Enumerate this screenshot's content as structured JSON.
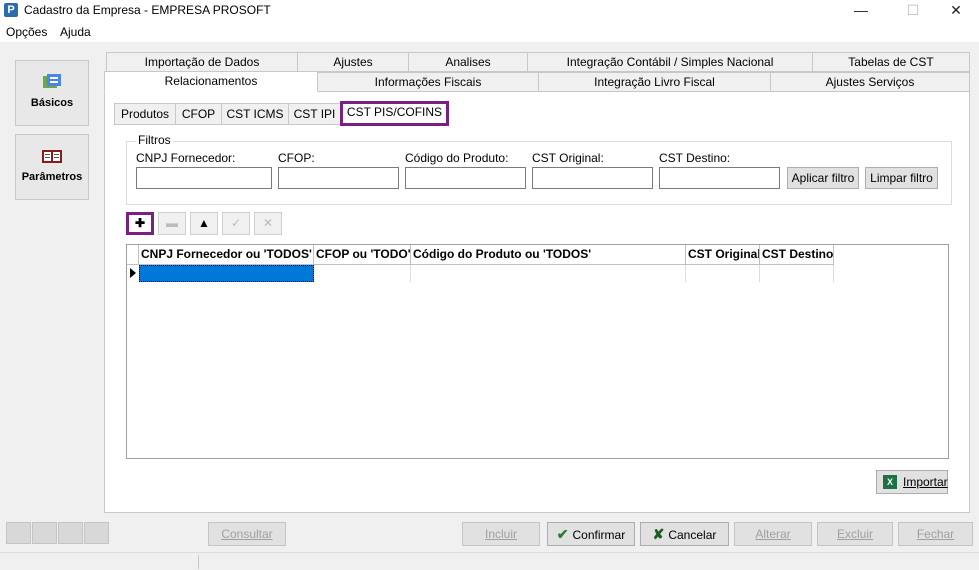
{
  "window": {
    "title": "Cadastro da Empresa - EMPRESA PROSOFT",
    "app_icon": "P",
    "minimize": "—",
    "maximize": "☐",
    "close": "✕"
  },
  "menu": {
    "items": [
      "Opções",
      "Ajuda"
    ]
  },
  "sidebar": {
    "items": [
      {
        "label": "Básicos",
        "icon": "basics-icon"
      },
      {
        "label": "Parâmetros",
        "icon": "parameters-icon"
      }
    ]
  },
  "tabs": {
    "row1": [
      "Importação de Dados",
      "Ajustes",
      "Analises",
      "Integração Contábil / Simples Nacional",
      "Tabelas de CST"
    ],
    "row2": [
      "Relacionamentos",
      "Informações Fiscais",
      "Integração Livro Fiscal",
      "Ajustes Serviços"
    ],
    "active": "Relacionamentos"
  },
  "subtabs": {
    "items": [
      "Produtos",
      "CFOP",
      "CST ICMS",
      "CST IPI",
      "CST PIS/COFINS"
    ],
    "active": "CST PIS/COFINS"
  },
  "filters": {
    "legend": "Filtros",
    "labels": [
      "CNPJ Fornecedor:",
      "CFOP:",
      "Código do Produto:",
      "CST Original:",
      "CST Destino:"
    ],
    "values": [
      "",
      "",
      "",
      "",
      ""
    ],
    "apply_label": "Aplicar filtro",
    "clear_label": "Limpar filtro"
  },
  "navigator": {
    "add": "✚",
    "delete": "▬",
    "up": "▲",
    "post": "✓",
    "cancel": "✕"
  },
  "grid": {
    "columns": [
      "CNPJ Fornecedor ou 'TODOS'",
      "CFOP ou 'TODO'",
      "Código do Produto ou 'TODOS'",
      "CST Original",
      "CST Destino"
    ],
    "rows": [
      [
        "",
        "",
        "",
        "",
        ""
      ]
    ]
  },
  "import_label": "Importar",
  "bottom": {
    "consultar": "Consultar",
    "incluir": "Incluir",
    "confirmar": "Confirmar",
    "cancelar": "Cancelar",
    "alterar": "Alterar",
    "excluir": "Excluir",
    "fechar": "Fechar"
  },
  "colors": {
    "highlight": "#7b1f84",
    "selection": "#0078d7"
  }
}
